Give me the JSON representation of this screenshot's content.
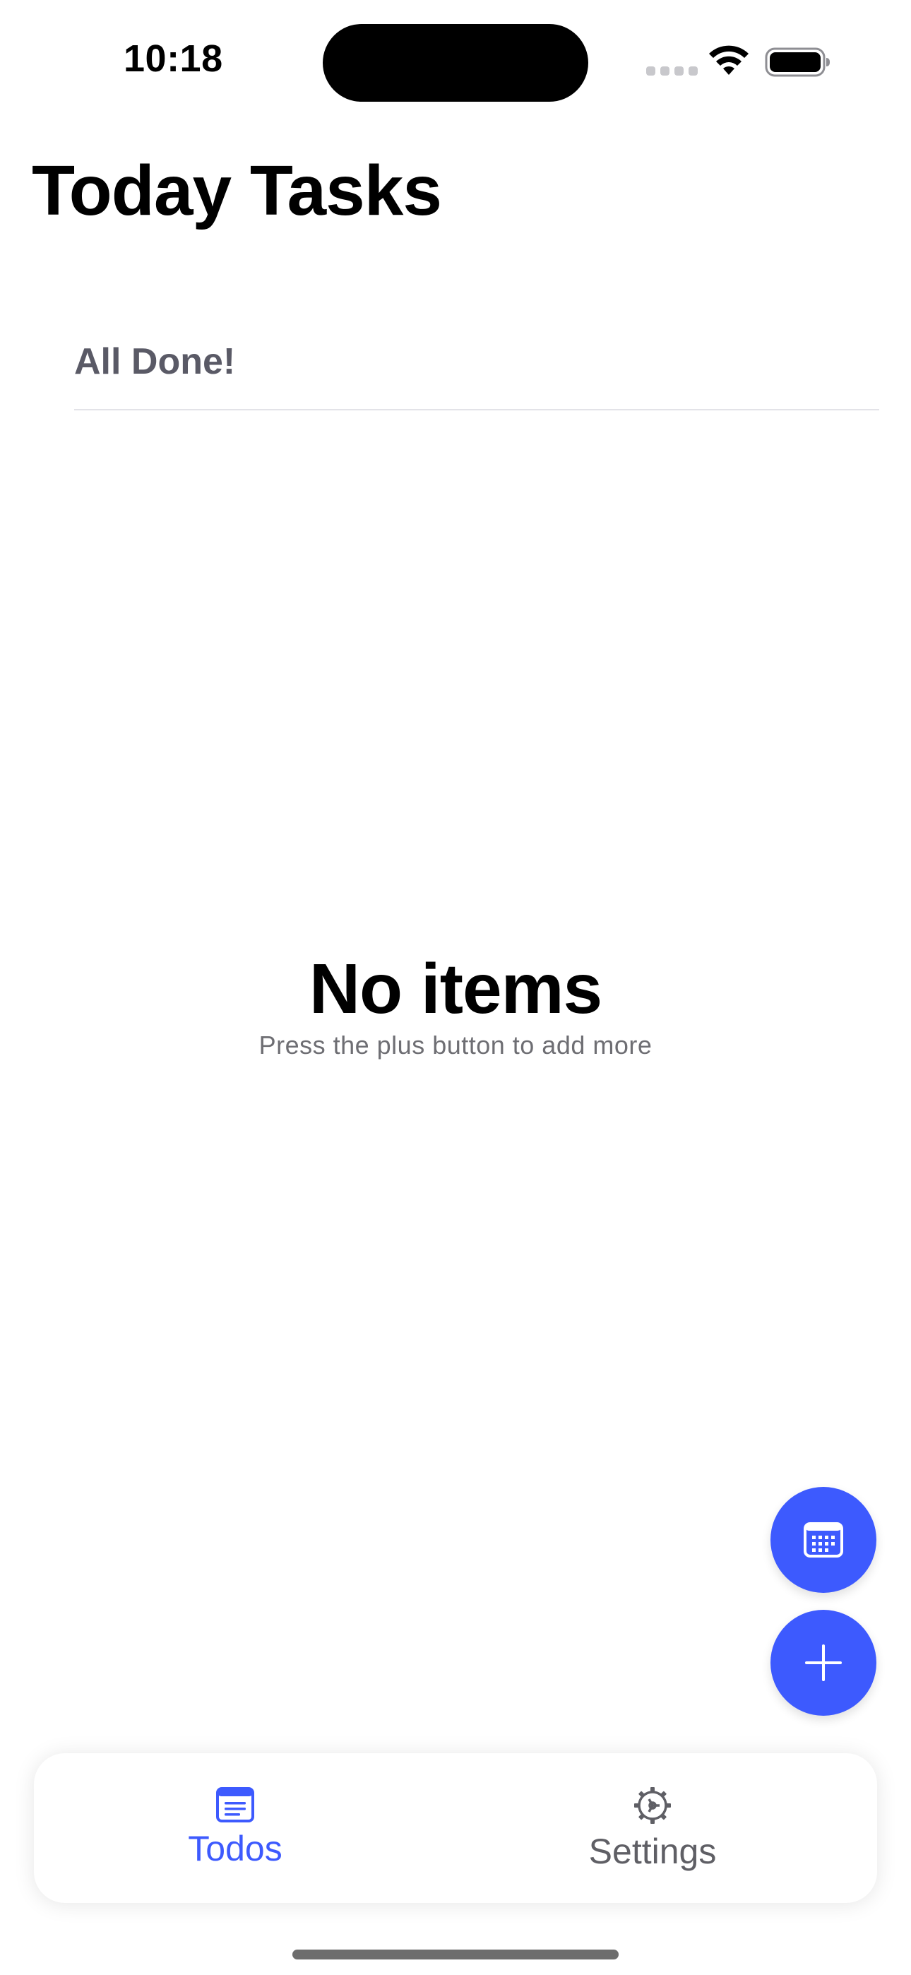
{
  "status_bar": {
    "time": "10:18",
    "wifi_icon": "wifi-icon",
    "battery_icon": "battery-full-icon",
    "signal_icon": "cellular-signal-empty-icon"
  },
  "header": {
    "title": "Today Tasks"
  },
  "list": {
    "section_header": "All Done!"
  },
  "empty_state": {
    "title": "No items",
    "subtitle": "Press the plus button to add more"
  },
  "fabs": {
    "calendar_icon": "calendar-icon",
    "add_icon": "plus-icon"
  },
  "tab_bar": {
    "items": [
      {
        "label": "Todos",
        "icon": "list-icon",
        "selected": true
      },
      {
        "label": "Settings",
        "icon": "gear-icon",
        "selected": false
      }
    ]
  },
  "colors": {
    "accent": "#3d5afe",
    "section_header": "#5a5a66",
    "subtitle": "#6e6e73",
    "inactive_tab": "#5f5f65"
  }
}
